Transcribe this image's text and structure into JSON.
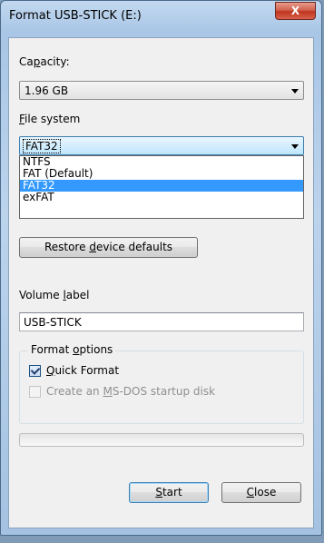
{
  "window": {
    "title": "Format USB-STICK (E:)",
    "close_label": "X"
  },
  "capacity": {
    "label": "Capacity:",
    "value": "1.96 GB"
  },
  "file_system": {
    "label": "File system",
    "value": "FAT32",
    "options": [
      "NTFS",
      "FAT (Default)",
      "FAT32",
      "exFAT"
    ],
    "highlighted_option": "FAT32"
  },
  "restore_button": {
    "label": "Restore device defaults"
  },
  "volume_label": {
    "label": "Volume label",
    "value": "USB-STICK"
  },
  "format_options": {
    "title": "Format options",
    "quick_format": {
      "label": "Quick Format",
      "checked": true
    },
    "msdos_startup": {
      "label": "Create an MS-DOS startup disk",
      "checked": false,
      "enabled": false
    }
  },
  "progress": {
    "value": 0
  },
  "buttons": {
    "start": "Start",
    "close": "Close"
  },
  "colors": {
    "selection": "#3399ff",
    "close_button": "#c0351f"
  }
}
